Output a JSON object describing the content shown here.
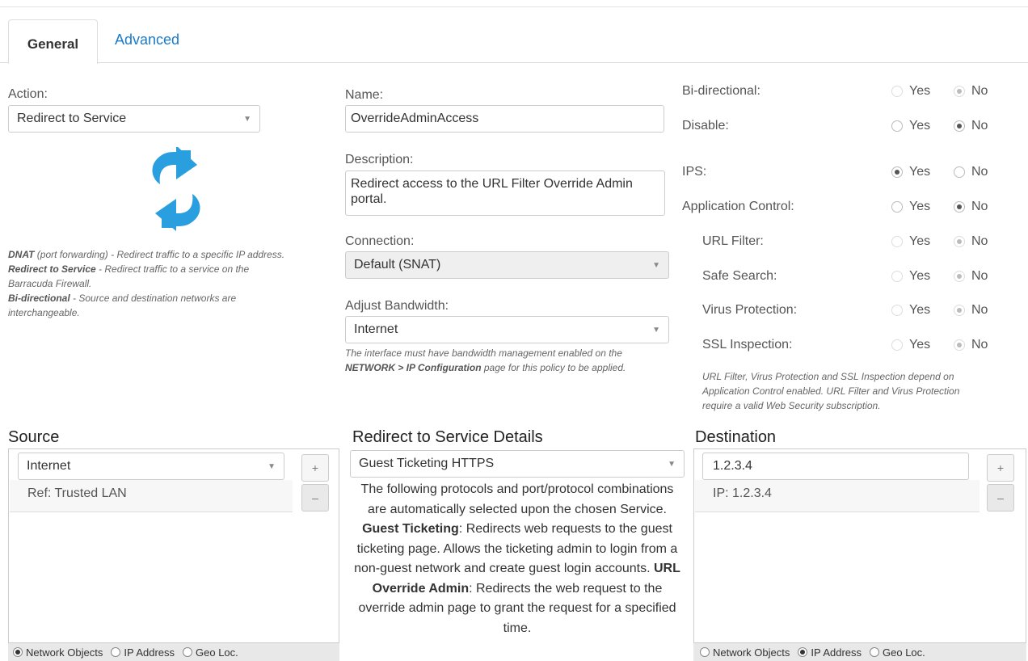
{
  "tabs": {
    "general": "General",
    "advanced": "Advanced"
  },
  "action": {
    "label": "Action:",
    "value": "Redirect to Service"
  },
  "help_action": [
    {
      "b": "DNAT",
      "t": " (port forwarding) - Redirect traffic to a specific IP address."
    },
    {
      "b": "Redirect to Service",
      "t": " - Redirect traffic to a service on the Barracuda Firewall."
    },
    {
      "b": "Bi-directional",
      "t": " - Source and destination networks are interchangeable."
    }
  ],
  "name": {
    "label": "Name:",
    "value": "OverrideAdminAccess"
  },
  "description": {
    "label": "Description:",
    "value": "Redirect access to the URL Filter Override Admin portal."
  },
  "connection": {
    "label": "Connection:",
    "value": "Default (SNAT)"
  },
  "bandwidth": {
    "label": "Adjust Bandwidth:",
    "value": "Internet",
    "help_1": "The interface must have bandwidth management enabled on the ",
    "help_b": "NETWORK > IP Configuration",
    "help_2": " page for this policy to be applied."
  },
  "options": {
    "yes": "Yes",
    "no": "No",
    "rows": [
      {
        "label": "Bi-directional:",
        "value": "No",
        "enabled": false
      },
      {
        "label": "Disable:",
        "value": "No",
        "enabled": true
      },
      {
        "label": "IPS:",
        "value": "Yes",
        "enabled": true
      },
      {
        "label": "Application Control:",
        "value": "No",
        "enabled": true
      },
      {
        "label": "URL Filter:",
        "value": "No",
        "enabled": false
      },
      {
        "label": "Safe Search:",
        "value": "No",
        "enabled": false
      },
      {
        "label": "Virus Protection:",
        "value": "No",
        "enabled": false
      },
      {
        "label": "SSL Inspection:",
        "value": "No",
        "enabled": false
      }
    ],
    "note": "URL Filter, Virus Protection and SSL Inspection depend on Application Control enabled. URL Filter and Virus Protection require a valid Web Security subscription."
  },
  "source": {
    "title": "Source",
    "select": "Internet",
    "item": "Ref: Trusted LAN",
    "add": "+",
    "remove": "–",
    "types": [
      "Network Objects",
      "IP Address",
      "Geo Loc."
    ],
    "selected_type": "Network Objects"
  },
  "details": {
    "title": "Redirect to Service Details",
    "select": "Guest Ticketing HTTPS",
    "text_1": "The following protocols and port/protocol combinations are automatically selected upon the chosen Service. ",
    "b_1": "Guest Ticketing",
    "text_2": ": Redirects web requests to the guest ticketing page. Allows the ticketing admin to login from a non-guest network and create guest login accounts. ",
    "b_2": "URL Override Admin",
    "text_3": ": Redirects the web request to the override admin page to grant the request for a specified time."
  },
  "destination": {
    "title": "Destination",
    "input": "1.2.3.4",
    "item": "IP: 1.2.3.4",
    "add": "+",
    "remove": "–",
    "types": [
      "Network Objects",
      "IP Address",
      "Geo Loc."
    ],
    "selected_type": "IP Address"
  }
}
